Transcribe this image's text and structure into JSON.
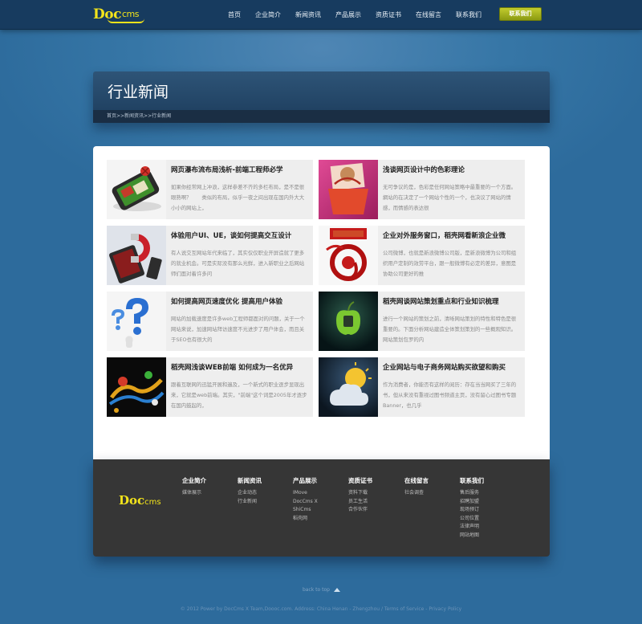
{
  "header": {
    "logo_text": "Doc",
    "logo_suffix": "cms",
    "nav": [
      "首页",
      "企业简介",
      "新闻资讯",
      "产品展示",
      "资质证书",
      "在线留言",
      "联系我们"
    ],
    "contact_button": "联系我们"
  },
  "page": {
    "title": "行业新闻",
    "breadcrumb": "首页>>新闻资讯>>行业新闻"
  },
  "news": [
    {
      "title": "网页瀑布流布局浅析-前端工程师必学",
      "summary": "如果你经常网上冲浪，这样参差不齐的多栏布局，是不是很眼熟啊？　　类似的布局，似乎一夜之间出现在国内外大大小小的网站上，",
      "thumb": "phone-icon"
    },
    {
      "title": "浅谈网页设计中的色彩理论",
      "summary": "无可争议的是，色彩是任何网站策略中最重要的一个方面。 網站的在决定了一个网站个性的一个，也决议了网站的情感，而情感的表达很",
      "thumb": "fashion-image"
    },
    {
      "title": "体验用户UI、UE，谈如何提高交互设计",
      "summary": "有人说交互网站年代来临了，其实仅仅职业开屏造就了更多的就业机会。可是实际没有那么光鲜，进入新职业之后网站师们面对着许多问",
      "thumb": "magnet-icon"
    },
    {
      "title": "企业对外服务窗口，稻壳网看新浪企业微",
      "summary": "公司微博，也就是新浪微博公司版，是新浪微博为公司和组织用户定制的效劳平台，跟一般微博有必定的差异，意图是协助公司更好的推",
      "thumb": "weibo-image"
    },
    {
      "title": "如何提高网页速度优化 提高用户体验",
      "summary": "网站的加载速度是许多web工程师都面对的问题，关于一个网站来说，加速网站拜访速度不光进步了用户体会，而且关于SEO也有很大的",
      "thumb": "question-icon"
    },
    {
      "title": "稻壳网谈网站策划重点和行业知识梳理",
      "summary": "进行一个网站的策划之前，清晰网站策划的特性和特色是很重要的。下面分析网站建造全体策划策划的一些概观知识。网站策划包罗的内",
      "thumb": "apple-icon"
    },
    {
      "title": "稻壳网浅谈WEB前端 如何成为一名优异",
      "summary": "跟着互联网的迅猛开展和遍及，一个新式的职业逐步显现出来，它就是web前端。其实，\"前端\"这个词是2005年才逐步在国内鼓起的，",
      "thumb": "splash-image"
    },
    {
      "title": "企业网站与电子商务网站购买欲望和购买",
      "summary": "作为消费者，你能否有这样的阅历：存在当当网买了三年的书，但从来没有重视过图书频道主页，没有留心过图书专题Banner，也几乎",
      "thumb": "weather-icon"
    }
  ],
  "footer": {
    "logo_text": "Doc",
    "logo_suffix": "cms",
    "columns": [
      {
        "title": "企业简介",
        "links": [
          "媒体展示"
        ]
      },
      {
        "title": "新闻资讯",
        "links": [
          "企业动态",
          "行业新闻"
        ]
      },
      {
        "title": "产品展示",
        "links": [
          "IMove",
          "DocCms X",
          "ShiCms",
          "稻壳网"
        ]
      },
      {
        "title": "资质证书",
        "links": [
          "资料下载",
          "员工生活",
          "合作伙伴"
        ]
      },
      {
        "title": "在线留言",
        "links": [
          "社会调查"
        ]
      },
      {
        "title": "联系我们",
        "links": [
          "售后服务",
          "招聘加盟",
          "现场预订",
          "公司位置",
          "法律声明",
          "网站地图"
        ]
      }
    ]
  },
  "back_to_top": "back to top",
  "copyright": "© 2012 Power by DocCms X Team,Doooc.com. Address: China Henan  -  Zhengzhou / Terms of Service - Privacy Policy",
  "colors": {
    "accent": "#f2e31b",
    "button": "#a7b31c",
    "background": "#2f6e9f",
    "header": "#173b5f"
  }
}
